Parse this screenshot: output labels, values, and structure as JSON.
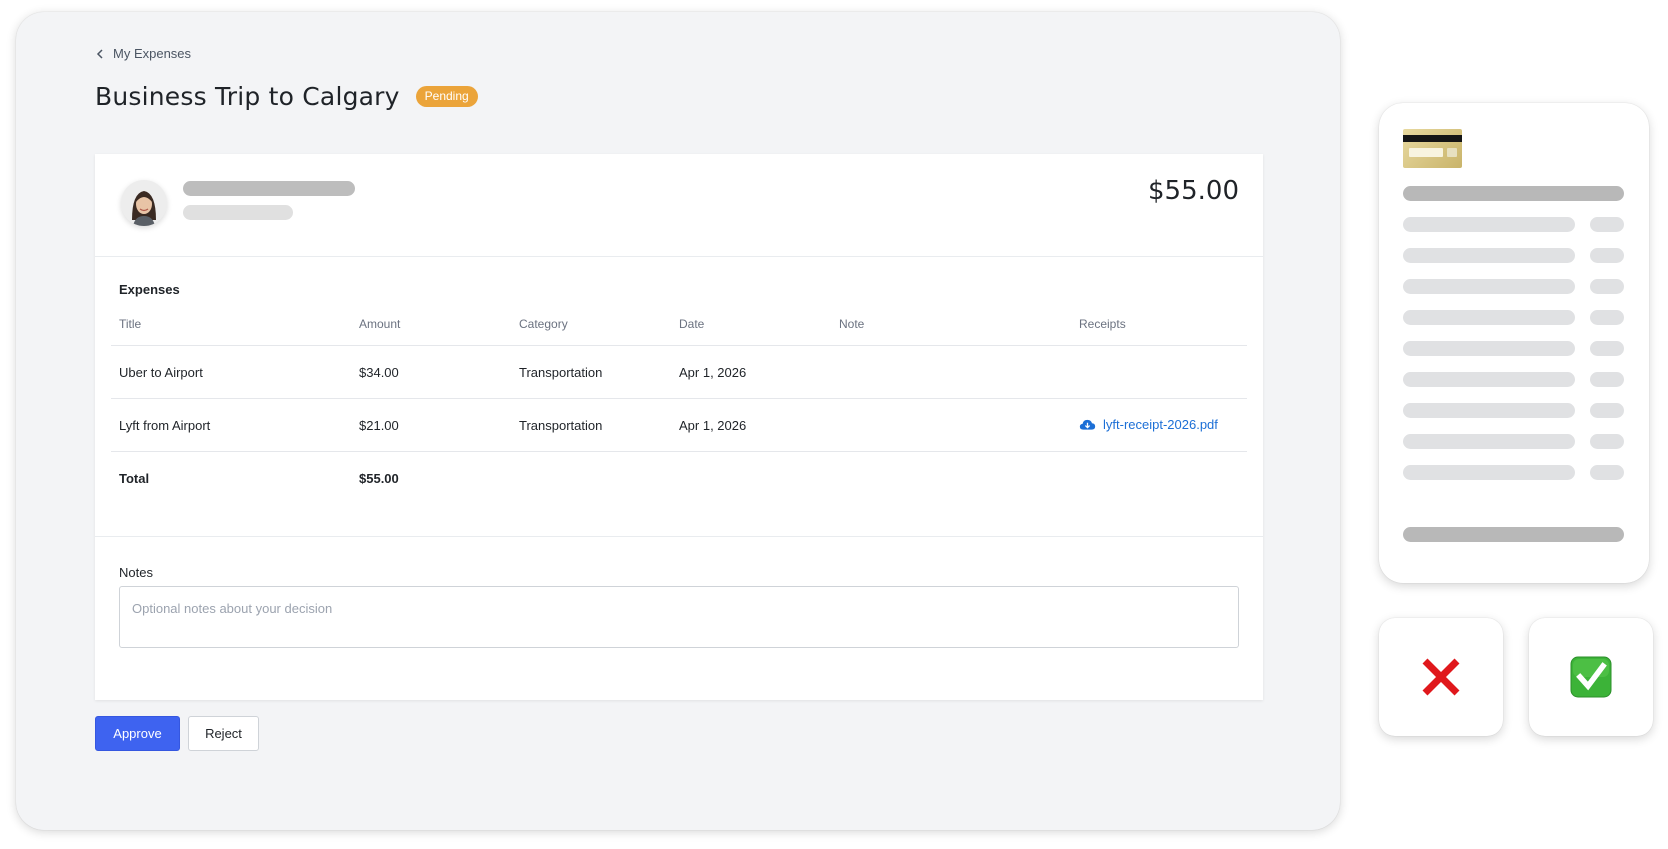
{
  "breadcrumb": {
    "label": "My Expenses",
    "icon": "chevron-left-icon"
  },
  "header": {
    "title": "Business Trip to Calgary",
    "status": "Pending",
    "status_color": "#eba43a"
  },
  "summary": {
    "total_amount": "$55.00"
  },
  "expenses": {
    "section_title": "Expenses",
    "columns": [
      "Title",
      "Amount",
      "Category",
      "Date",
      "Note",
      "Receipts"
    ],
    "rows": [
      {
        "title": "Uber to Airport",
        "amount": "$34.00",
        "category": "Transportation",
        "date": "Apr 1, 2026",
        "note": "",
        "receipt": ""
      },
      {
        "title": "Lyft from Airport",
        "amount": "$21.00",
        "category": "Transportation",
        "date": "Apr 1, 2026",
        "note": "",
        "receipt": "lyft-receipt-2026.pdf"
      }
    ],
    "total": {
      "label": "Total",
      "amount": "$55.00"
    }
  },
  "notes": {
    "label": "Notes",
    "placeholder": "Optional notes about your decision",
    "value": ""
  },
  "actions": {
    "approve_label": "Approve",
    "reject_label": "Reject",
    "approve_color": "#3e63f0"
  },
  "decision_icons": {
    "reject": "red-x-icon",
    "approve": "green-check-icon"
  },
  "colors": {
    "link": "#1c6fd6",
    "background": "#f3f4f6"
  }
}
